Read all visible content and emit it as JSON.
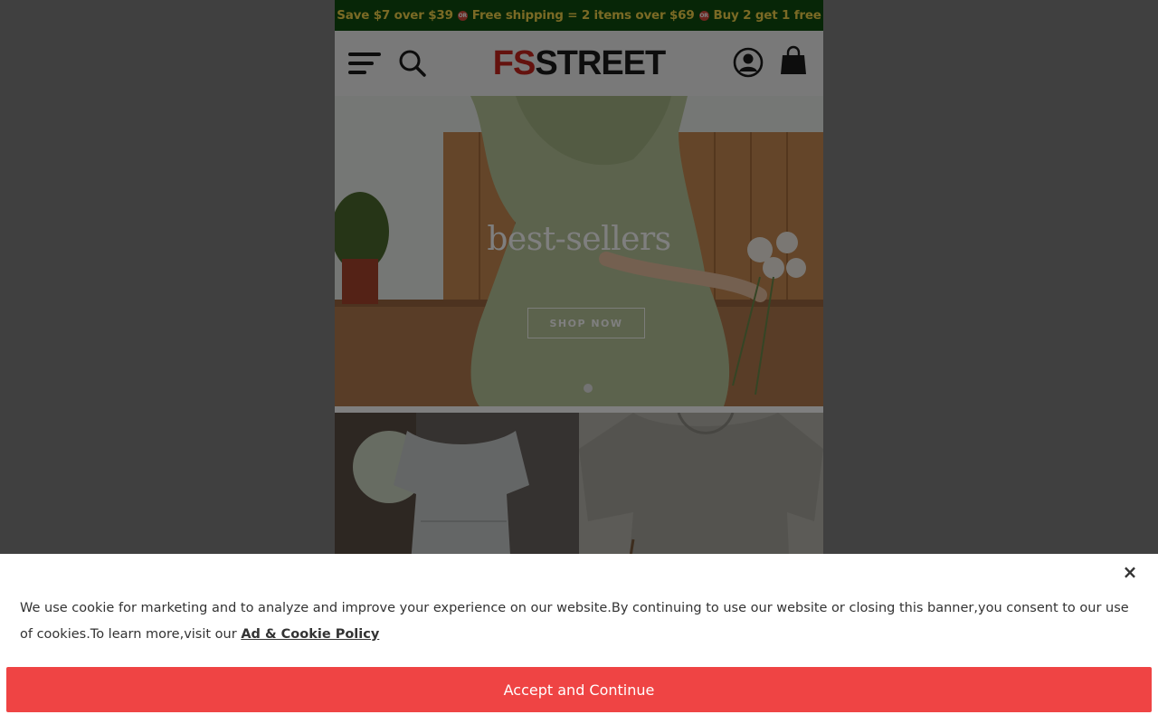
{
  "promo": {
    "part1": "Save $7 over $39",
    "sep_label": "OR",
    "part2": "Free shipping = 2 items over $69",
    "part3": "Buy 2 get 1 free"
  },
  "header": {
    "logo_fs": "FS",
    "logo_street": "STREET",
    "icons": [
      "menu-icon",
      "search-icon",
      "account-icon",
      "cart-icon"
    ]
  },
  "hero": {
    "title": "best-sellers",
    "button_label": "SHOP NOW"
  },
  "cookie": {
    "close_label": "×",
    "text": "We use cookie for marketing and to analyze and improve your experience on our website.By continuing to use our website or closing this banner,you consent to our use of cookies.To learn more,visit our ",
    "link_label": "Ad & Cookie Policy",
    "accept_label": "Accept and Continue"
  },
  "colors": {
    "promo_bg": "#0f4d0f",
    "promo_text": "#f5d44a",
    "logo_red": "#c8241c",
    "accept_bg": "#ef4444"
  }
}
